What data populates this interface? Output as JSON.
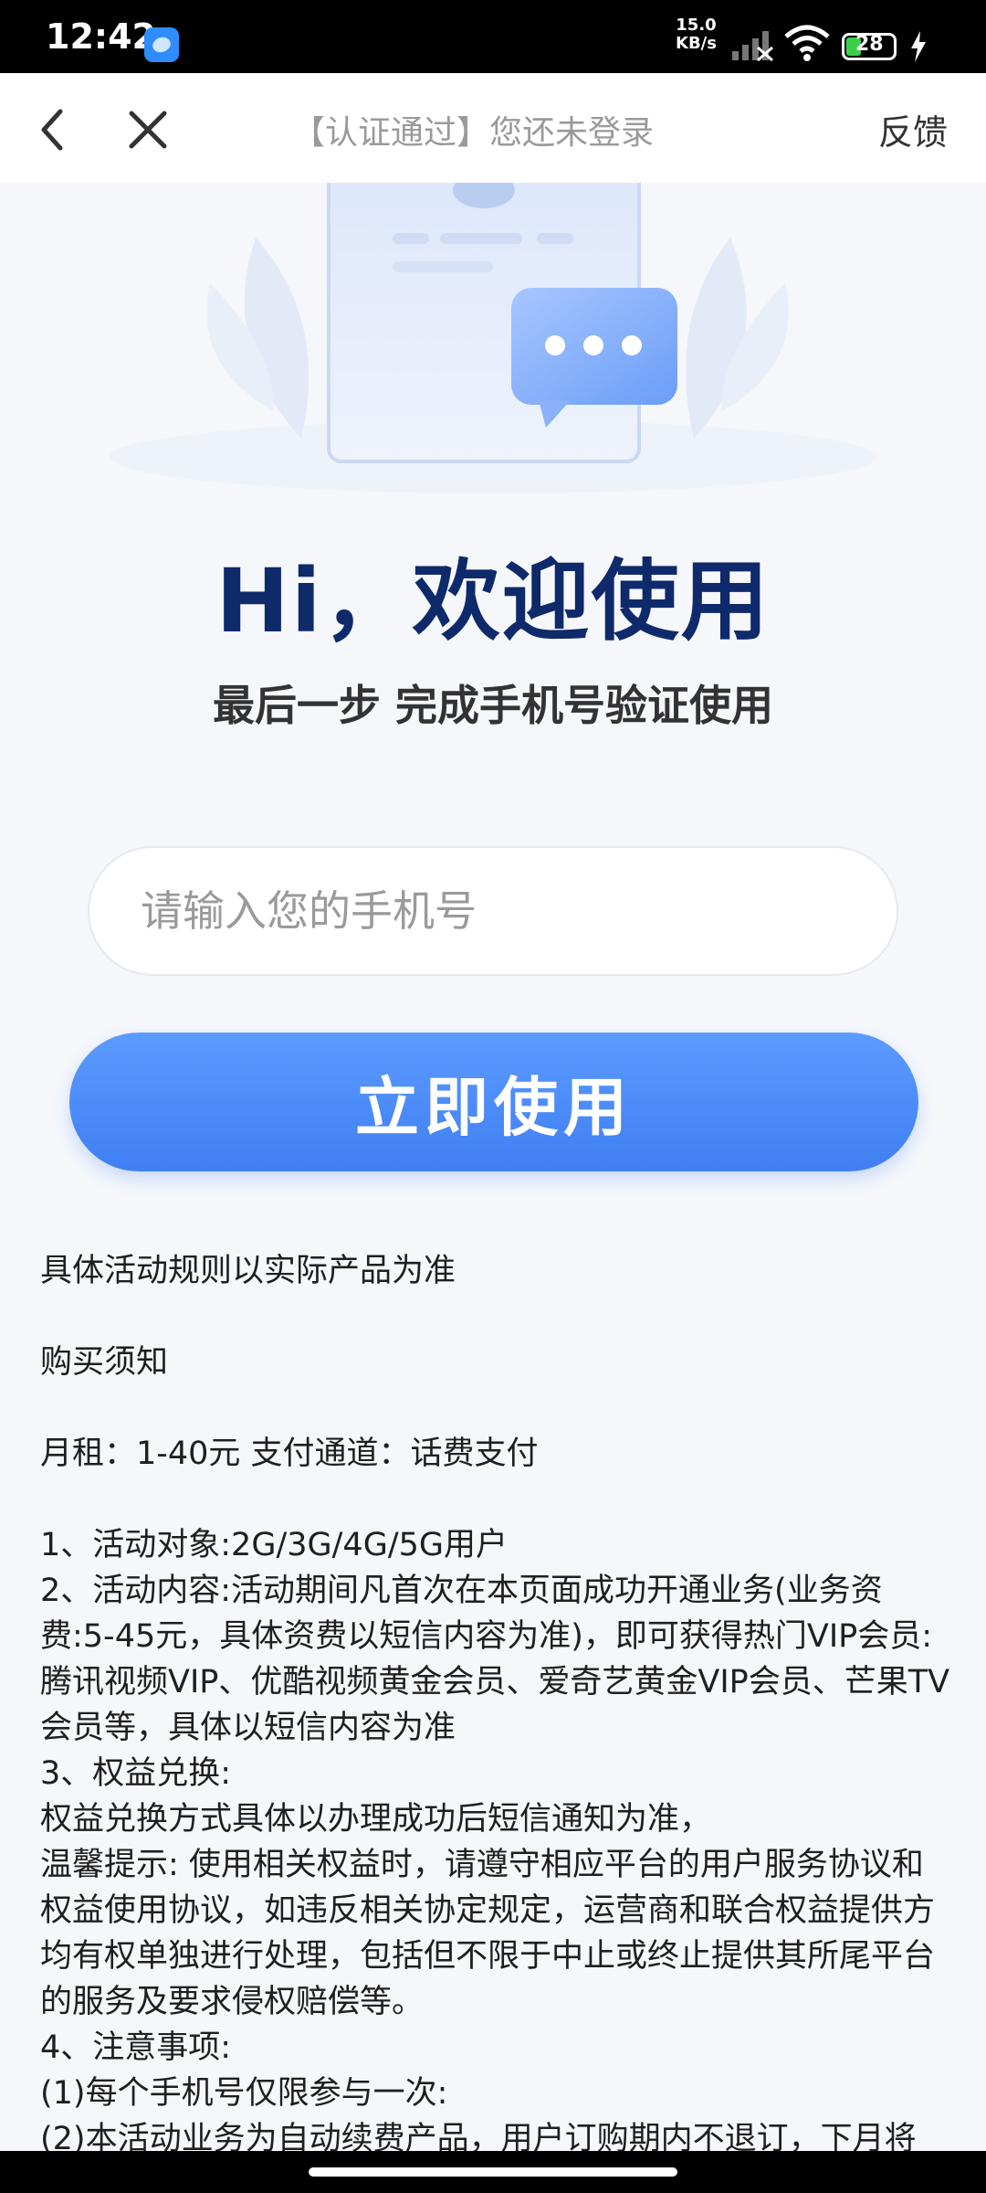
{
  "status_bar": {
    "time": "12:42",
    "net_speed_value": "15.0",
    "net_speed_unit": "KB/s",
    "battery": "28",
    "icons": [
      "app-icon",
      "signal-icon",
      "wifi-icon",
      "battery-icon",
      "charging-icon"
    ]
  },
  "nav": {
    "title": "【认证通过】您还未登录",
    "feedback": "反馈",
    "icons": [
      "back-icon",
      "close-icon"
    ]
  },
  "hero": {
    "title": "Hi，欢迎使用",
    "subtitle": "最后一步 完成手机号验证使用"
  },
  "form": {
    "phone_placeholder": "请输入您的手机号",
    "submit_label": "立即使用"
  },
  "rules": {
    "notice": "具体活动规则以实际产品为准",
    "purchase_heading": "购买须知",
    "fee_line": "月租：1-40元  支付通道：话费支付",
    "items": [
      "1、活动对象:2G/3G/4G/5G用户",
      "2、活动内容:活动期间凡首次在本页面成功开通业务(业务资费:5-45元，具体资费以短信内容为准)，即可获得热门VIP会员:腾讯视频VIP、优酷视频黄金会员、爱奇艺黄金VIP会员、芒果TV会员等，具体以短信内容为准",
      "3、权益兑换:",
      "权益兑换方式具体以办理成功后短信通知为准，",
      "温馨提示: 使用相关权益时，请遵守相应平台的用户服务协议和权益使用协议，如违反相关协定规定，运营商和联合权益提供方均有权单独进行处理，包括但不限于中止或终止提供其所尾平台的服务及要求侵权赔偿等。",
      "4、注意事项:",
      "(1)每个手机号仅限参与一次:",
      "(2)本活动业务为自动续费产品，用户订购期内不退订，下月将"
    ]
  },
  "colors": {
    "primary": "#3f7ff2",
    "title": "#0f2a6b"
  }
}
